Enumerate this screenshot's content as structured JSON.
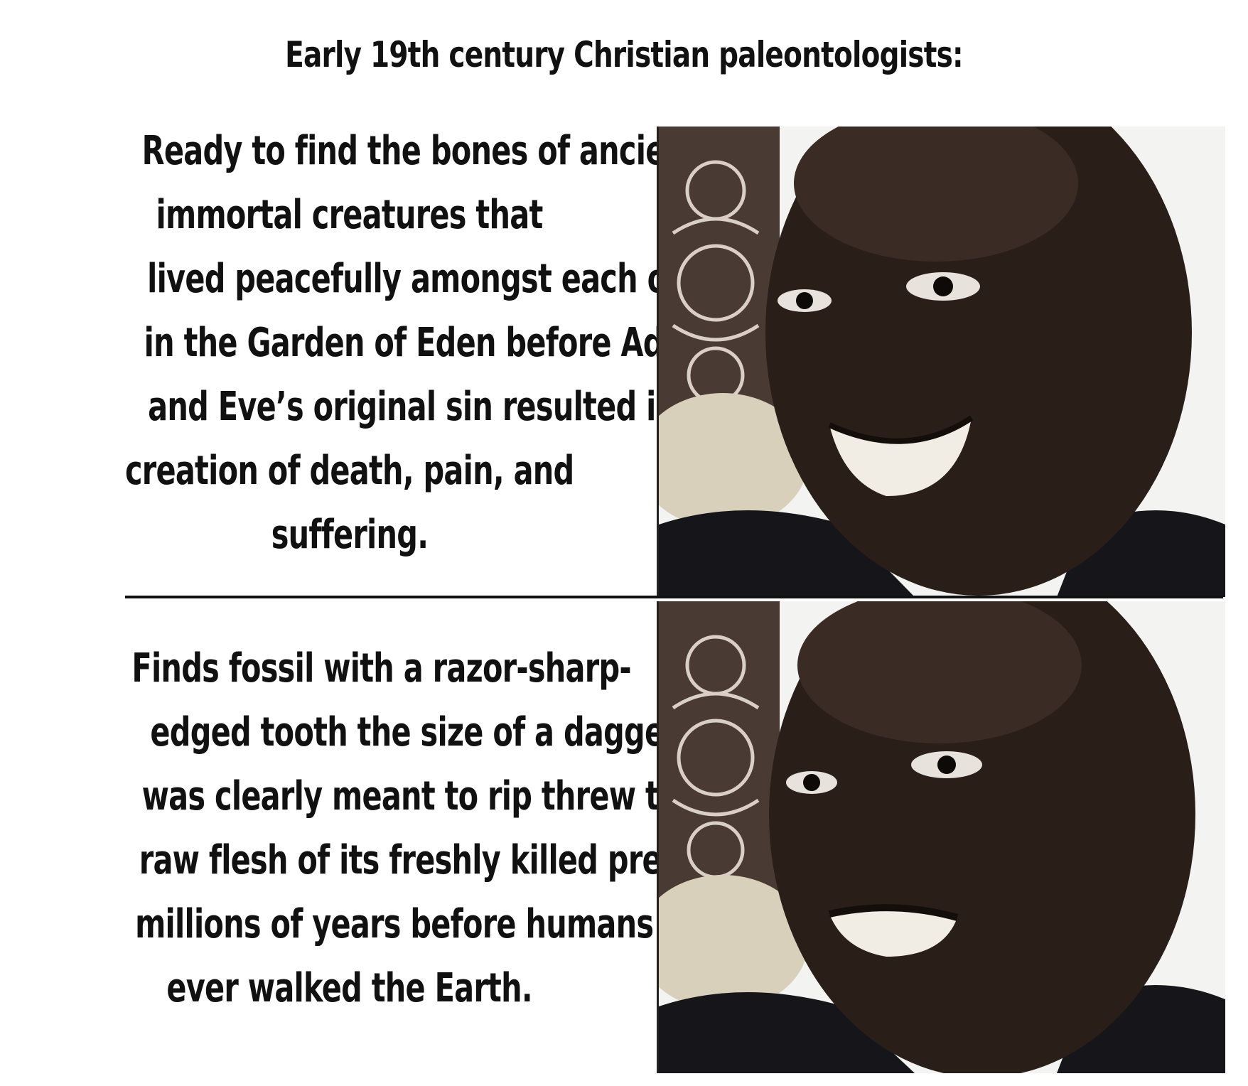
{
  "meme": {
    "title": "Early 19th century Christian paleontologists:",
    "panels": [
      {
        "lines": [
          "Ready to find the bones of ancient",
          "immortal creatures that",
          "lived peacefully amongst each other",
          "in the Garden of Eden before Adam",
          "and Eve’s original sin resulted in the",
          "creation of death, pain, and",
          "suffering."
        ],
        "expression": "happy"
      },
      {
        "lines": [
          "Finds fossil with a razor-sharp-",
          "edged tooth the size of a dagger that",
          "was clearly meant to rip threw the",
          "raw flesh of its freshly killed prey",
          "millions of years before humans",
          "ever walked the Earth."
        ],
        "expression": "disappointed"
      }
    ]
  },
  "colors": {
    "background": "#ffffff",
    "text": "#111111",
    "skin": "#2a1e18",
    "shirt": "#16161a",
    "wall": "#f3f3f1",
    "carving": "#4a3a34"
  }
}
